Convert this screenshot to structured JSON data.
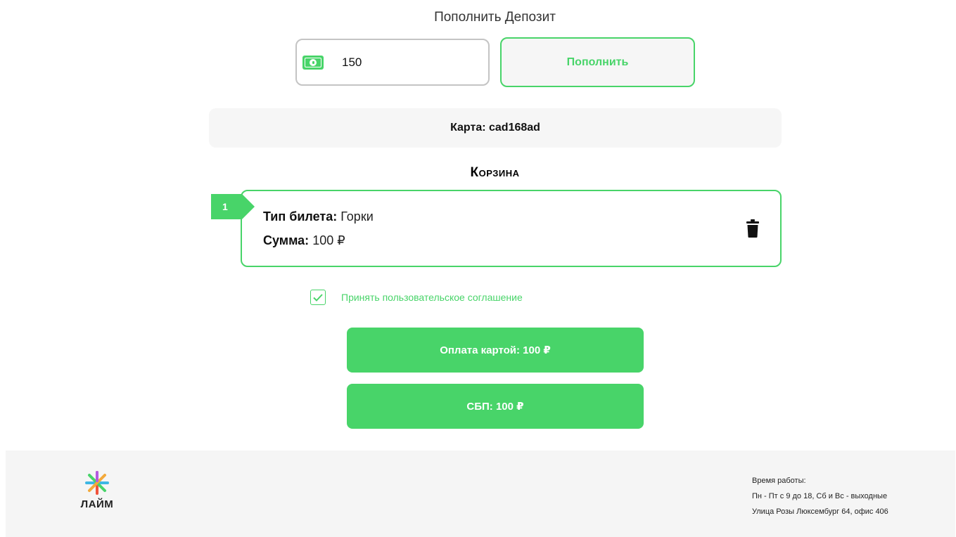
{
  "deposit": {
    "title": "Пополнить Депозит",
    "amount_value": "150",
    "topup_label": "Пополнить"
  },
  "card": {
    "label": "Карта: cad168ad"
  },
  "cart": {
    "title": "Корзина",
    "items": [
      {
        "index": "1",
        "type_label": "Тип билета:",
        "type_value": "Горки",
        "sum_label": "Сумма:",
        "sum_value": "100 ₽"
      }
    ]
  },
  "agreement": {
    "checked": true,
    "label": "Принять пользовательское соглашение"
  },
  "payment": {
    "card_label": "Оплата картой: 100 ₽",
    "sbp_label": "СБП: 100 ₽"
  },
  "footer": {
    "logo_text": "ЛАЙМ",
    "hours_title": "Время работы:",
    "hours_value": "Пн - Пт с 9 до 18, Сб и Вс - выходные",
    "address": "Улица Розы Люксембург 64, офис 406"
  },
  "colors": {
    "accent": "#48d469",
    "panel": "#f6f6f6",
    "footer_bg": "#f5f5f5"
  },
  "icons": {
    "amount": "money-icon",
    "delete": "trash-icon",
    "check": "checkmark-icon",
    "logo": "lime-logo-icon"
  }
}
